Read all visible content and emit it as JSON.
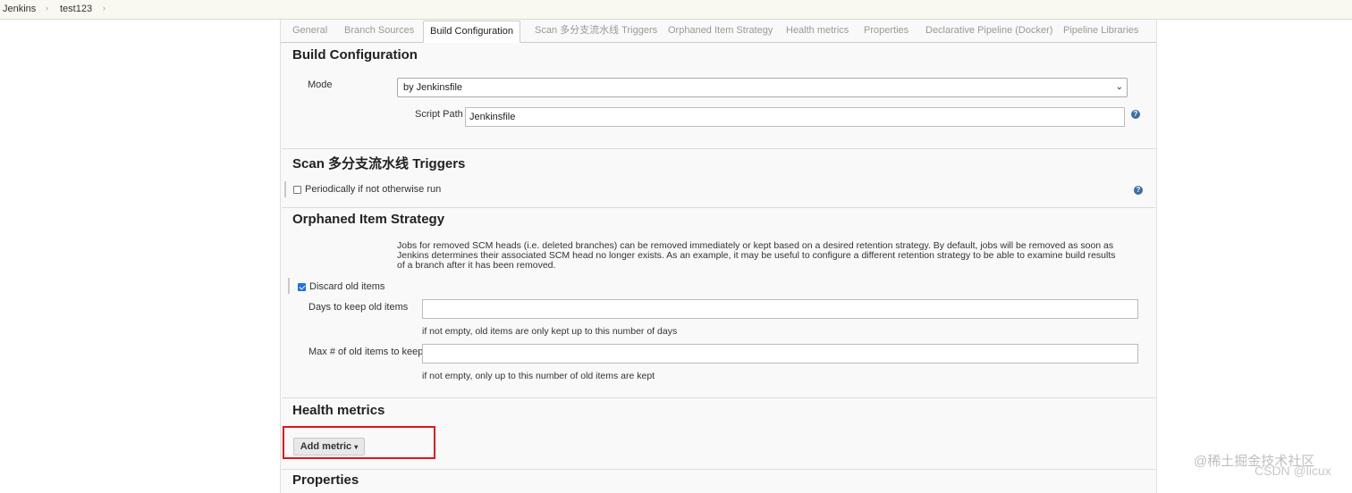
{
  "breadcrumb": {
    "items": [
      "Jenkins",
      "test123"
    ],
    "sep": "›"
  },
  "tabs": [
    "General",
    "Branch Sources",
    "Build Configuration",
    "Scan 多分支流水线 Triggers",
    "Orphaned Item Strategy",
    "Health metrics",
    "Properties",
    "Declarative Pipeline (Docker)",
    "Pipeline Libraries"
  ],
  "build_config": {
    "title": "Build Configuration",
    "mode_label": "Mode",
    "mode_value": "by Jenkinsfile",
    "script_path_label": "Script Path",
    "script_path_value": "Jenkinsfile"
  },
  "scan_triggers": {
    "title": "Scan 多分支流水线 Triggers",
    "periodic_label": "Periodically if not otherwise run",
    "periodic_checked": false
  },
  "orphaned": {
    "title": "Orphaned Item Strategy",
    "description": "Jobs for removed SCM heads (i.e. deleted branches) can be removed immediately or kept based on a desired retention strategy. By default, jobs will be removed as soon as Jenkins determines their associated SCM head no longer exists. As an example, it may be useful to configure a different retention strategy to be able to examine build results of a branch after it has been removed.",
    "discard_label": "Discard old items",
    "discard_checked": true,
    "days_label": "Days to keep old items",
    "days_value": "",
    "days_hint": "if not empty, old items are only kept up to this number of days",
    "max_label": "Max # of old items to keep",
    "max_value": "",
    "max_hint": "if not empty, only up to this number of old items are kept"
  },
  "health": {
    "title": "Health metrics",
    "add_metric_label": "Add metric"
  },
  "properties": {
    "title": "Properties"
  },
  "icons": {
    "help": "?",
    "dropdown": "▾",
    "select_chevron": "⌄"
  },
  "watermarks": [
    "@稀土掘金技术社区",
    "CSDN @licux"
  ],
  "colors": {
    "highlight_box": "#e0141e",
    "checkbox_checked": "#1a73e8",
    "help_icon": "#3a6ea5"
  }
}
